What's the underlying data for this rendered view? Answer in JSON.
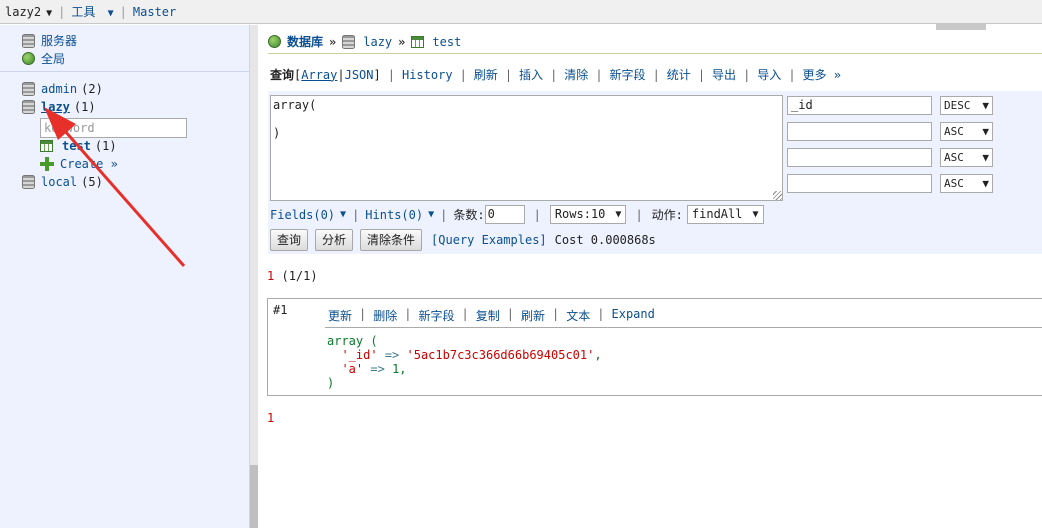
{
  "topbar": {
    "server": "lazy2",
    "server_caret": "▼",
    "sep": "|",
    "tools": "工具",
    "tools_caret": "▼",
    "mode": "Master"
  },
  "sidebar": {
    "servers": "服务器",
    "global": "全局",
    "databases": [
      {
        "name": "admin",
        "count": "(2)"
      },
      {
        "name": "lazy",
        "count": "(1)"
      },
      {
        "name": "local",
        "count": "(5)"
      }
    ],
    "keyword_placeholder": "keyword",
    "collection": {
      "name": "test",
      "count": "(1)"
    },
    "create": "Create »"
  },
  "breadcrumb": {
    "root": "数据库",
    "raquo": "»",
    "db": "lazy",
    "collection": "test"
  },
  "menu": {
    "query": "查询",
    "array": "Array",
    "json": "JSON",
    "history": "History",
    "refresh": "刷新",
    "insert": "插入",
    "clear": "清除",
    "new_field": "新字段",
    "stats": "统计",
    "export": "导出",
    "import": "导入",
    "more": "更多 »"
  },
  "query": {
    "text": "array(\n\n)",
    "sort_fields": [
      {
        "field": "_id",
        "order": "DESC"
      },
      {
        "field": "",
        "order": "ASC"
      },
      {
        "field": "",
        "order": "ASC"
      },
      {
        "field": "",
        "order": "ASC"
      }
    ],
    "fields": "Fields(0)",
    "hints": "Hints(0)",
    "limit_label": "条数:",
    "limit_value": "0",
    "rows": "Rows:10",
    "action_label": "动作:",
    "action": "findAll",
    "btn_query": "查询",
    "btn_explain": "分析",
    "btn_clear": "清除条件",
    "examples": "[Query Examples]",
    "cost": "Cost 0.000868s"
  },
  "results": {
    "page_num": "1",
    "page_info": "(1/1)",
    "index": "#1",
    "actions": [
      "更新",
      "删除",
      "新字段",
      "复制",
      "刷新",
      "文本",
      "Expand"
    ],
    "doc": {
      "id_key": "'_id'",
      "id_val": "'5ac1b7c3c366d66b69405c01'",
      "a_key": "'a'",
      "a_val": "1"
    },
    "bottom_page": "1"
  },
  "colors": {
    "link": "#0b4f91",
    "panel_bg": "#eef2ff",
    "arrow": "#e8302a",
    "page_red": "#cc0000"
  }
}
